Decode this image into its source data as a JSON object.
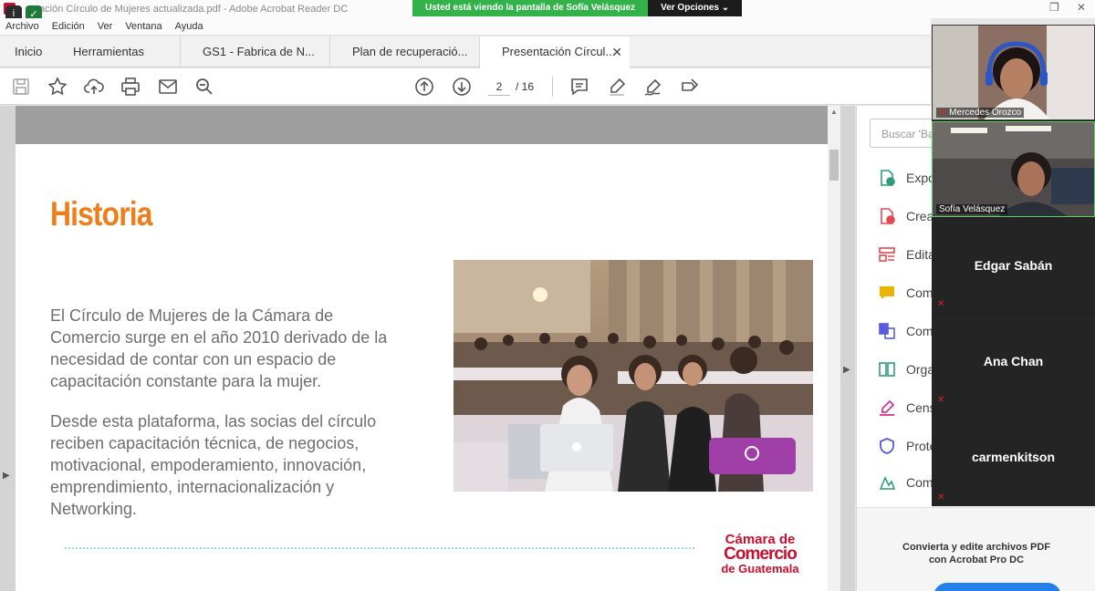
{
  "window": {
    "title": "tación Círculo de Mujeres actualizada.pdf - Adobe Acrobat Reader DC",
    "restore_glyph": "❐",
    "close_glyph": "✕"
  },
  "zoom_share": {
    "message": "Usted está viendo la pantalla de Sofía Velásquez",
    "options_label": "Ver Opciones ⌄"
  },
  "menu": [
    "Archivo",
    "Edición",
    "Ver",
    "Ventana",
    "Ayuda"
  ],
  "tabs": [
    {
      "label": "Inicio"
    },
    {
      "label": "Herramientas"
    },
    {
      "label": "GS1 - Fabrica de N..."
    },
    {
      "label": "Plan de recuperació..."
    },
    {
      "label": "Presentación Círcul...",
      "active": true,
      "close": "✕"
    }
  ],
  "toolbar": {
    "icons": [
      "save-icon",
      "bookmark-star-icon",
      "cloud-upload-icon",
      "print-icon",
      "mail-icon",
      "zoom-search-icon",
      "previous-page-icon",
      "next-page-icon",
      "comment-icon",
      "highlight-pen-icon",
      "sign-icon",
      "fill-sign-icon"
    ],
    "page_current": "2",
    "page_total": "/ 16"
  },
  "slide": {
    "heading": "Historia",
    "paragraph1": "El Círculo de Mujeres de la Cámara de Comercio surge en el año 2010 derivado de la necesidad de contar con un espacio de capacitación constante para la mujer.",
    "paragraph2": "Desde esta plataforma, las socias del círculo reciben capacitación técnica, de negocios, motivacional, empoderamiento, innovación, emprendimiento, internacionalización y Networking.",
    "logo": {
      "line1": "Cámara de",
      "line2": "Comercio",
      "line3": "de Guatemala"
    },
    "accent_color": "#ef7d1a",
    "logo_color": "#c8102e"
  },
  "tools_pane": {
    "search_placeholder": "Buscar 'Ba",
    "items": [
      {
        "label": "Expo",
        "icon": "export-pdf-icon",
        "color": "#2d9d78"
      },
      {
        "label": "Crea",
        "icon": "create-pdf-icon",
        "color": "#e34850"
      },
      {
        "label": "Edita",
        "icon": "edit-pdf-icon",
        "color": "#e34850"
      },
      {
        "label": "Com",
        "icon": "comment-tool-icon",
        "color": "#e8b600"
      },
      {
        "label": "Com",
        "icon": "combine-files-icon",
        "color": "#5a5ae0"
      },
      {
        "label": "Orga",
        "icon": "organize-pages-icon",
        "color": "#2d9d78"
      },
      {
        "label": "Cens",
        "icon": "redact-icon",
        "color": "#d83790"
      },
      {
        "label": "Prote",
        "icon": "protect-icon",
        "color": "#5a5ae0"
      },
      {
        "label": "Com",
        "icon": "compare-icon",
        "color": "#2d9d78"
      }
    ],
    "promo_line1": "Convierta y edite archivos PDF",
    "promo_line2": "con Acrobat Pro DC"
  },
  "participants": [
    {
      "name": "Mercedes Orozco",
      "video": true,
      "muted": true
    },
    {
      "name": "Sofía Velásquez",
      "video": true,
      "muted": false
    },
    {
      "name": "Edgar Sabán",
      "video": false,
      "muted": true
    },
    {
      "name": "Ana Chan",
      "video": false,
      "muted": true
    },
    {
      "name": "carmenkitson",
      "video": false,
      "muted": true
    }
  ]
}
